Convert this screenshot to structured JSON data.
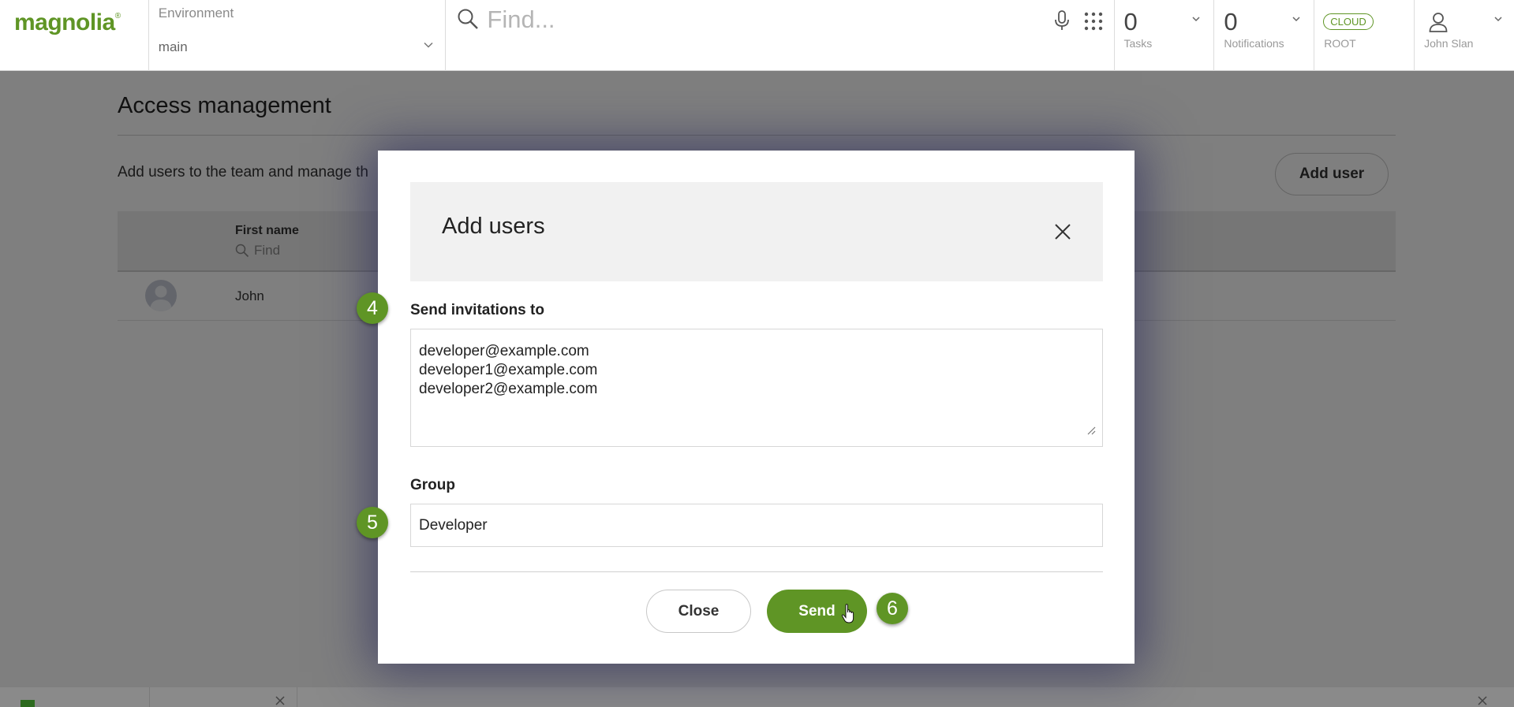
{
  "header": {
    "logo": "magnolia",
    "environment": {
      "label": "Environment",
      "value": "main"
    },
    "search": {
      "placeholder": "Find..."
    },
    "tasks": {
      "count": "0",
      "label": "Tasks"
    },
    "notifications": {
      "count": "0",
      "label": "Notifications"
    },
    "cloud": {
      "badge": "CLOUD",
      "label": "ROOT"
    },
    "user": {
      "name": "John Slan"
    }
  },
  "page": {
    "title": "Access management",
    "description": "Add users to the team and manage th",
    "add_user_label": "Add user",
    "table": {
      "columns": [
        {
          "label": "First name",
          "filter_placeholder": "Find"
        }
      ],
      "rows": [
        {
          "first_name": "John"
        }
      ]
    }
  },
  "dialog": {
    "title": "Add users",
    "invite_label": "Send invitations to",
    "invite_emails": [
      "developer@example.com",
      "developer1@example.com",
      "developer2@example.com"
    ],
    "group_label": "Group",
    "group_value": "Developer",
    "close_label": "Close",
    "send_label": "Send"
  },
  "steps": [
    "4",
    "5",
    "6"
  ],
  "colors": {
    "brand": "#5f9525",
    "overlay": "rgba(0,0,0,0.5)"
  },
  "icons": [
    "search-icon",
    "microphone-icon",
    "apps-grid-icon",
    "chevron-down-icon",
    "user-icon",
    "close-icon",
    "resize-handle-icon",
    "pointer-cursor-icon"
  ]
}
